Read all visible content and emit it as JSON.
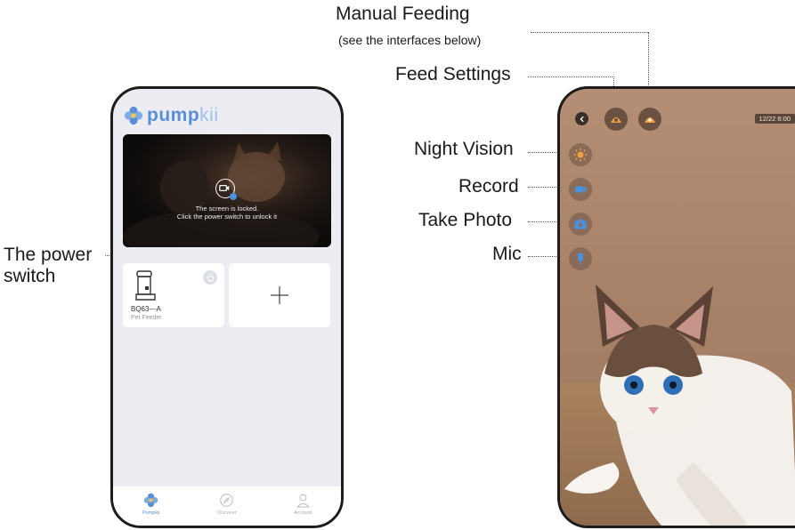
{
  "callouts": {
    "power_switch": [
      "The power",
      "switch"
    ],
    "manual_feeding": "Manual Feeding",
    "manual_feeding_note": "(see the interfaces below)",
    "feed_settings": "Feed Settings",
    "night_vision": "Night Vision",
    "record": "Record",
    "take_photo": "Take Photo",
    "mic": "Mic"
  },
  "app_screen": {
    "logo": {
      "bold": "pump",
      "light": "kii"
    },
    "camera_card": {
      "locked_line1": "The screen is locked.",
      "locked_line2": "Click the power switch to unlock it"
    },
    "device": {
      "name": "BQ63—A",
      "type": "Pet Feeder"
    },
    "tabs": [
      {
        "label": "Pumpkii",
        "icon": "pumpkii-flower-icon",
        "active": true
      },
      {
        "label": "Discover",
        "icon": "compass-icon",
        "active": false
      },
      {
        "label": "Account",
        "icon": "person-icon",
        "active": false
      }
    ]
  },
  "camera_screen": {
    "timestamp": "12/22 6:00",
    "controls": [
      "back",
      "feed-settings",
      "manual-feeding",
      "night-vision",
      "record",
      "take-photo",
      "mic"
    ]
  },
  "colors": {
    "brand_blue": "#5a8fd8",
    "camera_accent": "#f0a340",
    "control_blue": "#4a8fe0"
  }
}
